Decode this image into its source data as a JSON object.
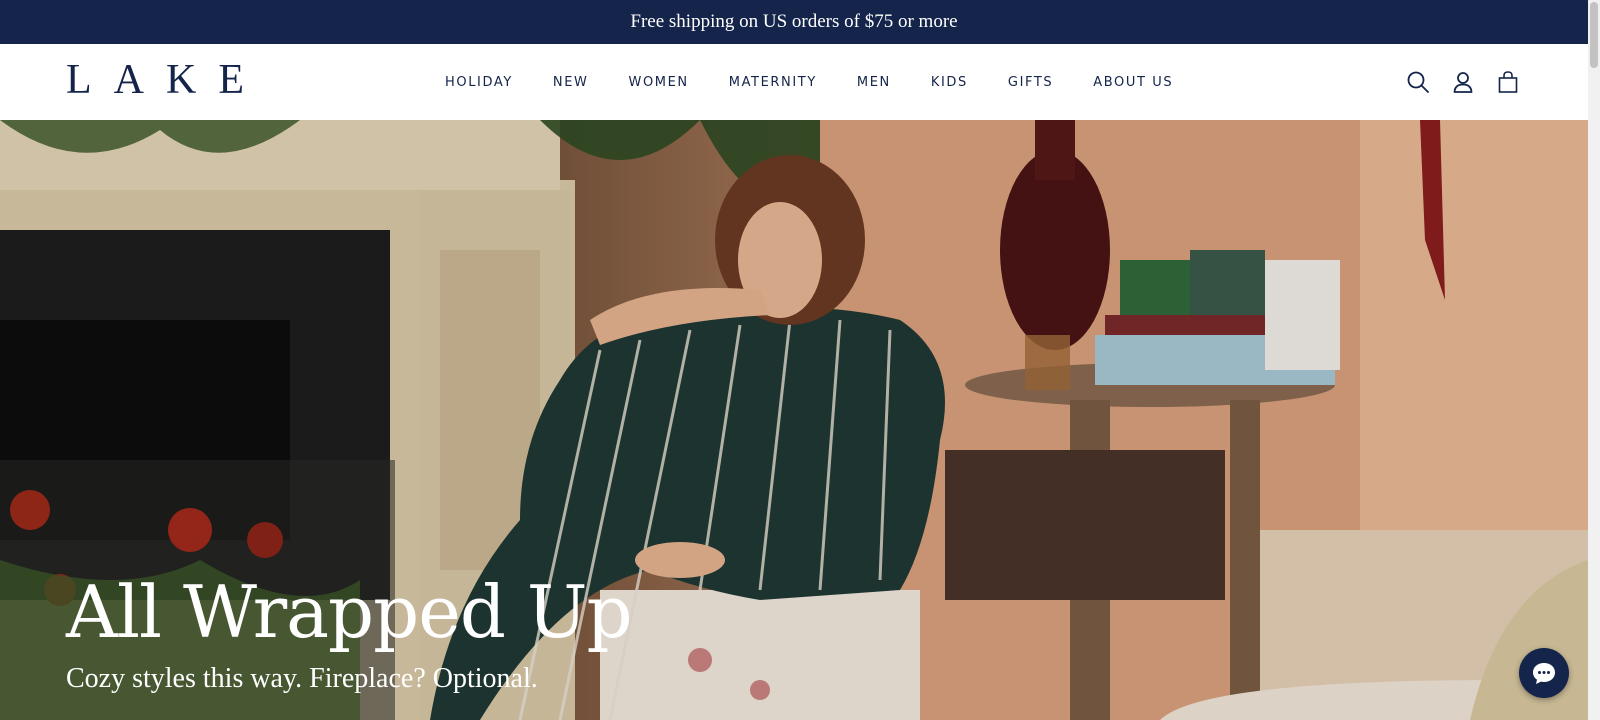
{
  "announcement": {
    "text": "Free shipping on US orders of $75 or more"
  },
  "header": {
    "logo": "LAKE",
    "nav": [
      {
        "label": "HOLIDAY"
      },
      {
        "label": "NEW"
      },
      {
        "label": "WOMEN"
      },
      {
        "label": "MATERNITY"
      },
      {
        "label": "MEN"
      },
      {
        "label": "KIDS"
      },
      {
        "label": "GIFTS"
      },
      {
        "label": "ABOUT US"
      }
    ],
    "icons": [
      "search-icon",
      "account-icon",
      "shopping-bag-icon"
    ]
  },
  "hero": {
    "title": "All Wrapped Up",
    "subtitle": "Cozy styles this way. Fireplace? Optional."
  },
  "chat": {
    "icon": "chat-bubble-icon"
  },
  "colors": {
    "navy": "#14244a",
    "white": "#ffffff"
  }
}
